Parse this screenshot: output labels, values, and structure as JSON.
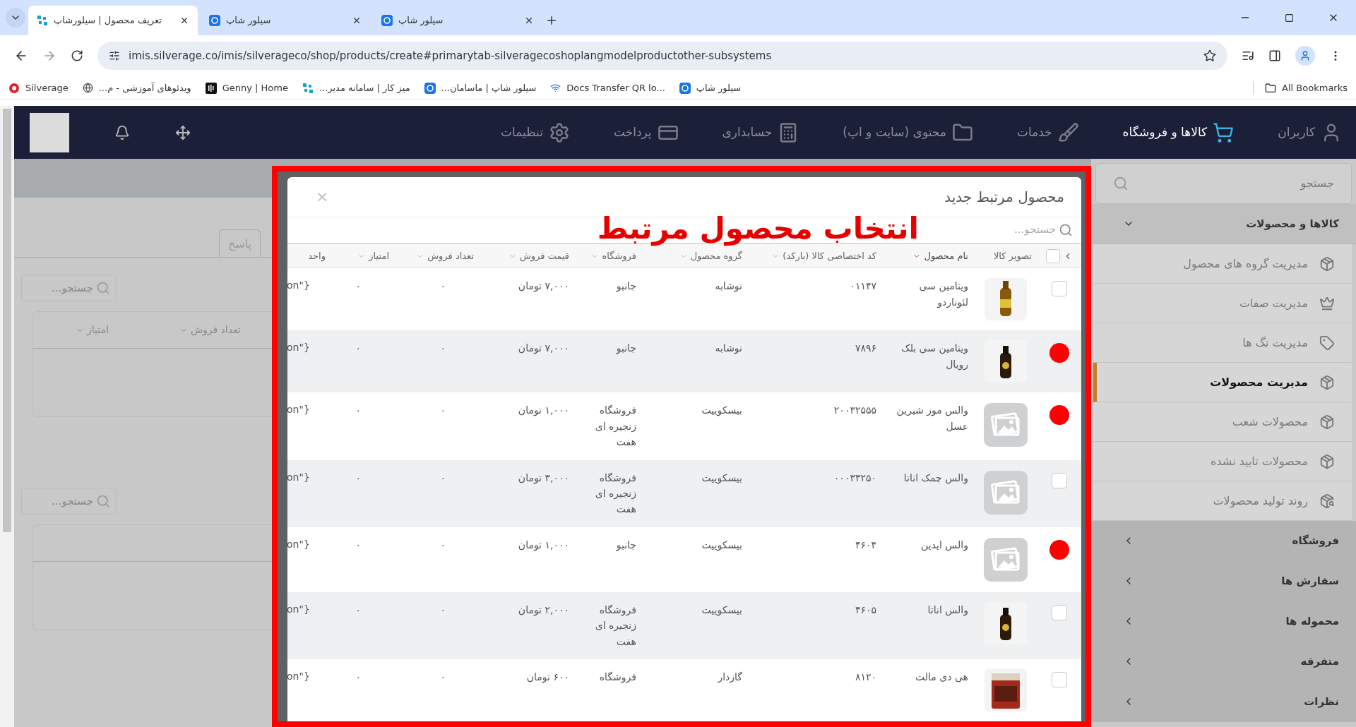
{
  "browser": {
    "tabs": [
      {
        "title": "سیلور شاپ",
        "selected": false
      },
      {
        "title": "سیلور شاپ",
        "selected": false
      },
      {
        "title": "تعریف محصول | سیلورشاپ",
        "selected": true
      }
    ],
    "address": "imis.silverage.co/imis/silverageco/shop/products/create#primarytab-silveragecoshoplangmodelproductother-subsystems",
    "bookmarks": [
      "سیلور شاپ",
      "Docs Transfer QR lo...",
      "سیلور شاپ | ماسامان...",
      "میز کار | سامانه مدیر...",
      "Genny | Home",
      "ویدئوهای آموزشی - م...",
      "Silverage"
    ],
    "all_bookmarks": "All Bookmarks"
  },
  "nav": {
    "items": [
      {
        "label": "کاربران",
        "selected": false
      },
      {
        "label": "کالاها و فروشگاه",
        "selected": true
      },
      {
        "label": "خدمات",
        "selected": false
      },
      {
        "label": "محتوی (سایت و اپ)",
        "selected": false
      },
      {
        "label": "حسابداری",
        "selected": false
      },
      {
        "label": "پرداخت",
        "selected": false
      },
      {
        "label": "تنظیمات",
        "selected": false
      }
    ]
  },
  "background_page": {
    "tab": "پاسخ",
    "search_fields": [
      {
        "placeholder": "جستجو..."
      },
      {
        "placeholder": "جستجو..."
      }
    ],
    "columns": [
      "تعداد فروش",
      "امتیاز"
    ]
  },
  "sidebar": {
    "search": {
      "placeholder": "جستجو"
    },
    "groups": [
      {
        "label": "کالاها و محصولات",
        "expanded": true,
        "items": [
          {
            "label": "مدیریت گروه های محصول",
            "selected": false
          },
          {
            "label": "مدیریت صفات",
            "selected": false
          },
          {
            "label": "مدیریت تگ ها",
            "selected": false
          },
          {
            "label": "مدیریت محصولات",
            "selected": true
          },
          {
            "label": "محصولات شعب",
            "selected": false
          },
          {
            "label": "محصولات تایید نشده",
            "selected": false
          },
          {
            "label": "روند تولید محصولات",
            "selected": false
          }
        ]
      },
      {
        "label": "فروشگاه",
        "expanded": false
      },
      {
        "label": "سفارش ها",
        "expanded": false
      },
      {
        "label": "محموله ها",
        "expanded": false
      },
      {
        "label": "متفرقه",
        "expanded": false
      },
      {
        "label": "نظرات",
        "expanded": false
      }
    ]
  },
  "modal": {
    "title": "محصول مرتبط جدید",
    "close": "×",
    "annotation": "انتخاب محصول مرتبط",
    "search": {
      "placeholder": "جستجو..."
    },
    "select_all": {
      "checked": false
    },
    "columns": [
      {
        "label": "تصویر کالا",
        "sortable": false
      },
      {
        "label": "نام محصول",
        "sortable": true,
        "sorted": true
      },
      {
        "label": "کد اختصاصی کالا (بارکد)",
        "sortable": true,
        "sorted": false
      },
      {
        "label": "گروه محصول",
        "sortable": true,
        "sorted": false
      },
      {
        "label": "فروشگاه",
        "sortable": true,
        "sorted": false
      },
      {
        "label": "قیمت فروش",
        "sortable": true,
        "sorted": false
      },
      {
        "label": "تعداد فروش",
        "sortable": true,
        "sorted": false
      },
      {
        "label": "امتیاز",
        "sortable": true,
        "sorted": false
      },
      {
        "label": "واحد",
        "sortable": false
      }
    ],
    "rows": [
      {
        "selected": false,
        "name": "ویتامین سی لئوناردو",
        "code": "۰۱۱۴۷",
        "group": "نوشابه",
        "store": "جانبو",
        "price": "۷,۰۰۰ تومان",
        "sales": "۰",
        "score": "۰",
        "unit": "on\"}"
      },
      {
        "selected": true,
        "name": "ویتامین سی بلک رویال",
        "code": "۷۸۹۶",
        "group": "نوشابه",
        "store": "جانبو",
        "price": "۷,۰۰۰ تومان",
        "sales": "۰",
        "score": "۰",
        "unit": "on\"}"
      },
      {
        "selected": true,
        "image": {
          "kind": "placeholder"
        },
        "name": "والس موز شیرین عسل",
        "code": "۲۰۰۳۲۵۵۵",
        "group": "بیسکوییت",
        "store": "فروشگاه زنجیره ای هفت",
        "price": "۱,۰۰۰ تومان",
        "sales": "۰",
        "score": "۰",
        "unit": "on\"}"
      },
      {
        "selected": false,
        "image": {
          "kind": "placeholder"
        },
        "name": "والس چمک اناتا",
        "code": "۰۰۰۳۳۲۵۰",
        "group": "بیسکوییت",
        "store": "فروشگاه زنجیره ای هفت",
        "price": "۳,۰۰۰ تومان",
        "sales": "۰",
        "score": "۰",
        "unit": "on\"}"
      },
      {
        "selected": true,
        "image": {
          "kind": "placeholder"
        },
        "name": "والس ایدین",
        "code": "۴۶۰۴",
        "group": "بیسکوییت",
        "store": "جانبو",
        "price": "۱,۰۰۰ تومان",
        "sales": "۰",
        "score": "۰",
        "unit": "on\"}"
      },
      {
        "selected": false,
        "name": "والس اناتا",
        "code": "۴۶۰۵",
        "group": "بیسکوییت",
        "store": "فروشگاه زنجیره ای هفت",
        "price": "۲,۰۰۰ تومان",
        "sales": "۰",
        "score": "۰",
        "unit": "on\"}"
      },
      {
        "selected": false,
        "name": "هی دی مالت",
        "code": "۸۱۲۰",
        "group": "گازدار",
        "store": "فروشگاه",
        "price": "۶۰۰ تومان",
        "sales": "۰",
        "score": "۰",
        "unit": "on\"}"
      }
    ]
  }
}
